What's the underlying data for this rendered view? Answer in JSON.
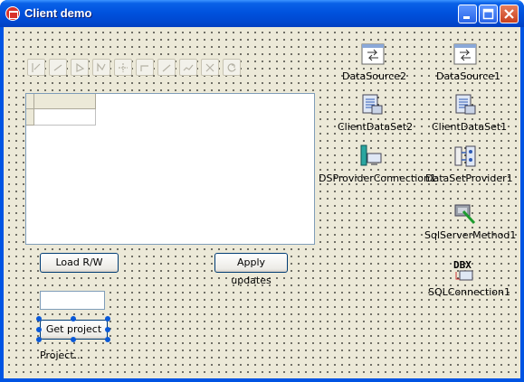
{
  "window": {
    "title": "Client demo",
    "buttons": [
      "minimize",
      "maximize",
      "close"
    ]
  },
  "toolbar": {
    "icons": [
      "navigator-first-icon",
      "navigator-prior-icon",
      "navigator-next-icon",
      "navigator-last-icon",
      "navigator-insert-icon",
      "navigator-delete-icon",
      "navigator-edit-icon",
      "navigator-post-icon",
      "navigator-cancel-icon",
      "navigator-refresh-icon"
    ]
  },
  "buttons": {
    "load_rw": "Load R/W",
    "apply_updates": "Apply updates",
    "get_project": "Get project"
  },
  "project_label": "Project...",
  "project_input": {
    "value": ""
  },
  "components": [
    {
      "name": "DataSource2",
      "icon": "datasource-icon"
    },
    {
      "name": "DataSource1",
      "icon": "datasource-icon"
    },
    {
      "name": "ClientDataSet2",
      "icon": "clientdataset-icon"
    },
    {
      "name": "ClientDataSet1",
      "icon": "clientdataset-icon"
    },
    {
      "name": "DSProviderConnection1",
      "icon": "dsproviderconnection-icon"
    },
    {
      "name": "DataSetProvider1",
      "icon": "datasetprovider-icon"
    },
    {
      "name": "SqlServerMethod1",
      "icon": "sqlservermethod-icon"
    },
    {
      "name": "SQLConnection1",
      "icon": "sqlconnection-icon",
      "badge": "DBX"
    }
  ],
  "colors": {
    "titlebar": "#0054e3",
    "form": "#ece9d8",
    "selection": "#0a59d8"
  }
}
